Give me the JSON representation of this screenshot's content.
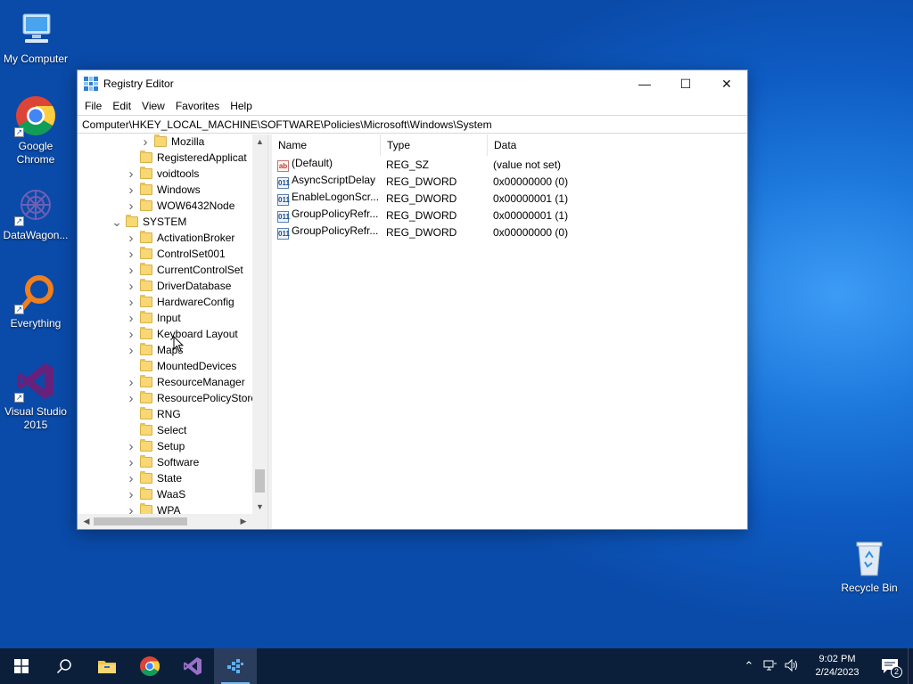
{
  "desktop": {
    "icons": [
      {
        "label": "My Computer",
        "icon": "computer-icon"
      },
      {
        "label": "Google Chrome",
        "icon": "chrome-icon"
      },
      {
        "label": "DataWagon...",
        "icon": "datawagon-icon"
      },
      {
        "label": "Everything",
        "icon": "everything-search-icon"
      },
      {
        "label": "Visual Studio 2015",
        "icon": "visual-studio-icon"
      },
      {
        "label": "Recycle Bin",
        "icon": "recycle-bin-icon"
      }
    ]
  },
  "window": {
    "title": "Registry Editor",
    "controls": {
      "minimize": "—",
      "maximize": "☐",
      "close": "✕"
    },
    "menu": [
      "File",
      "Edit",
      "View",
      "Favorites",
      "Help"
    ],
    "address": "Computer\\HKEY_LOCAL_MACHINE\\SOFTWARE\\Policies\\Microsoft\\Windows\\System"
  },
  "tree": {
    "items": [
      {
        "label": "Mozilla",
        "expander": "collapsed",
        "level": 2
      },
      {
        "label": "RegisteredApplicat",
        "expander": "none",
        "level": 1
      },
      {
        "label": "voidtools",
        "expander": "collapsed",
        "level": 1
      },
      {
        "label": "Windows",
        "expander": "collapsed",
        "level": 1
      },
      {
        "label": "WOW6432Node",
        "expander": "collapsed",
        "level": 1
      },
      {
        "label": "SYSTEM",
        "expander": "expanded",
        "level": 0
      },
      {
        "label": "ActivationBroker",
        "expander": "collapsed",
        "level": 1
      },
      {
        "label": "ControlSet001",
        "expander": "collapsed",
        "level": 1
      },
      {
        "label": "CurrentControlSet",
        "expander": "collapsed",
        "level": 1
      },
      {
        "label": "DriverDatabase",
        "expander": "collapsed",
        "level": 1
      },
      {
        "label": "HardwareConfig",
        "expander": "collapsed",
        "level": 1
      },
      {
        "label": "Input",
        "expander": "collapsed",
        "level": 1
      },
      {
        "label": "Keyboard Layout",
        "expander": "collapsed",
        "level": 1
      },
      {
        "label": "Maps",
        "expander": "collapsed",
        "level": 1
      },
      {
        "label": "MountedDevices",
        "expander": "none",
        "level": 1
      },
      {
        "label": "ResourceManager",
        "expander": "collapsed",
        "level": 1
      },
      {
        "label": "ResourcePolicyStore",
        "expander": "collapsed",
        "level": 1
      },
      {
        "label": "RNG",
        "expander": "none",
        "level": 1
      },
      {
        "label": "Select",
        "expander": "none",
        "level": 1
      },
      {
        "label": "Setup",
        "expander": "collapsed",
        "level": 1
      },
      {
        "label": "Software",
        "expander": "collapsed",
        "level": 1
      },
      {
        "label": "State",
        "expander": "collapsed",
        "level": 1
      },
      {
        "label": "WaaS",
        "expander": "collapsed",
        "level": 1
      },
      {
        "label": "WPA",
        "expander": "collapsed",
        "level": 1
      }
    ]
  },
  "values": {
    "columns": [
      "Name",
      "Type",
      "Data"
    ],
    "rows": [
      {
        "name": "(Default)",
        "type": "REG_SZ",
        "data": "(value not set)",
        "kind": "sz"
      },
      {
        "name": "AsyncScriptDelay",
        "type": "REG_DWORD",
        "data": "0x00000000 (0)",
        "kind": "dword"
      },
      {
        "name": "EnableLogonScr...",
        "type": "REG_DWORD",
        "data": "0x00000001 (1)",
        "kind": "dword"
      },
      {
        "name": "GroupPolicyRefr...",
        "type": "REG_DWORD",
        "data": "0x00000001 (1)",
        "kind": "dword"
      },
      {
        "name": "GroupPolicyRefr...",
        "type": "REG_DWORD",
        "data": "0x00000000 (0)",
        "kind": "dword"
      }
    ]
  },
  "taskbar": {
    "apps": [
      "start-icon",
      "search-icon",
      "file-explorer-icon",
      "chrome-icon",
      "visual-studio-icon",
      "registry-editor-icon"
    ],
    "active_app": "registry-editor-icon",
    "clock_time": "9:02 PM",
    "clock_date": "2/24/2023",
    "notification_count": "2"
  }
}
